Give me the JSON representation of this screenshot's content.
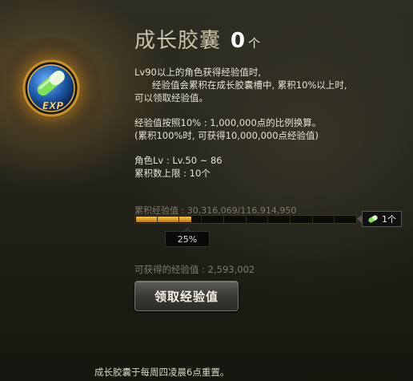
{
  "header": {
    "title": "成长胶囊",
    "count": "0",
    "count_unit": "个"
  },
  "emblem": {
    "icon": "exp-capsule-icon",
    "label": "EXP"
  },
  "description": {
    "line1": "Lv90以上的角色获得经验值时,",
    "line2": "经验值会累积在成长胶囊槽中, 累积10%以上时,",
    "line3": "可以领取经验值。",
    "line4": "经验值按照10% : 1,000,000点的比例换算。",
    "line5": "(累积100%时, 可获得10,000,000点经验值)",
    "line6": "角色Lv : Lv.50 ~ 86",
    "line7": "累积数上限 : 10个"
  },
  "progress": {
    "label": "累积经验值 : 30,316,069/116,914,950",
    "percent_label": "25%",
    "fraction": 0.25,
    "segments": 10
  },
  "badge": {
    "icon": "capsule-icon",
    "text": "1个"
  },
  "obtainable": "可获得的经验值 : 2,593,002",
  "claim_button": "领取经验值",
  "footer": "成长胶囊于每周四凌晨6点重置。",
  "colors": {
    "accent_gold": "#f5c04e",
    "orb_blue": "#1d5aa8"
  }
}
